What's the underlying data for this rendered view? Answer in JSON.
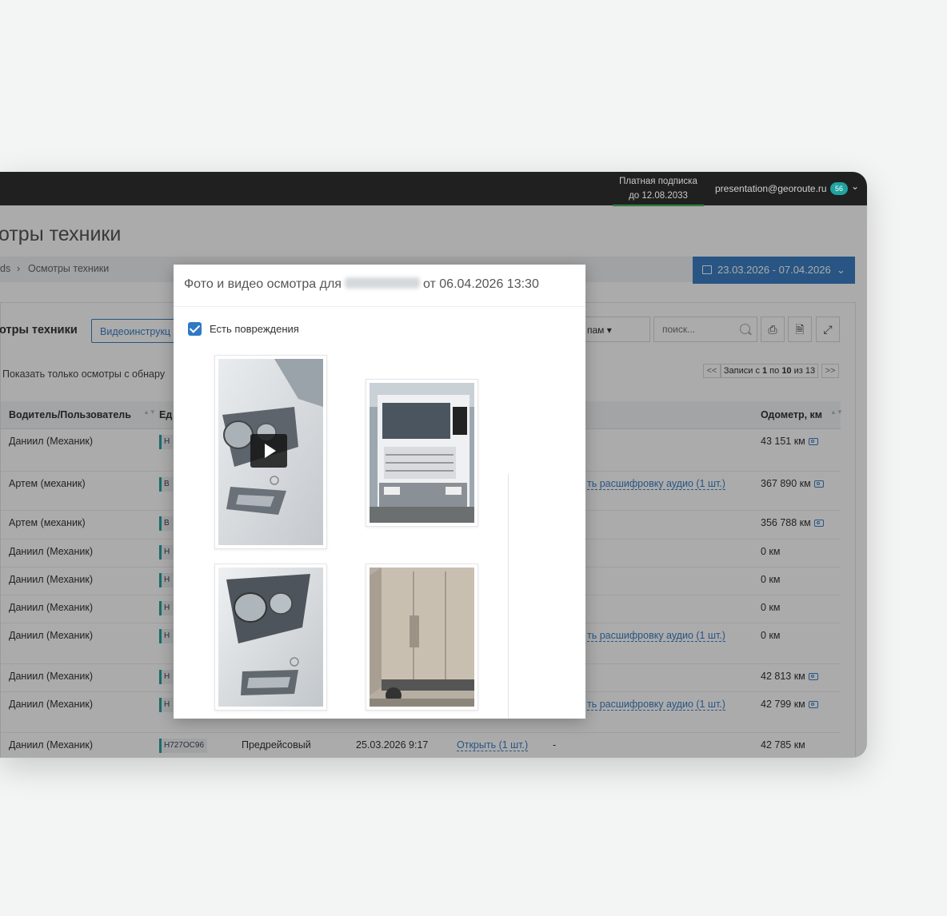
{
  "topbar": {
    "subscription_line1": "Платная подписка",
    "subscription_line2": "до 12.08.2033",
    "email": "presentation@georoute.ru",
    "badge_count": "56"
  },
  "page": {
    "title": "отры техники",
    "breadcrumb_root": "ds",
    "breadcrumb_current": "Осмотры техники",
    "date_range": "23.03.2026 - 07.04.2026"
  },
  "toolbar": {
    "panel_title": "отры техники",
    "video_button": "Видеоинструкц",
    "filter_label": "пам",
    "search_placeholder": "поиск...",
    "show_only_label": "Показать только осмотры с обнару"
  },
  "pager": {
    "prev": "<<",
    "text_prefix": "Записи с ",
    "from": "1",
    "text_mid": " по ",
    "to": "10",
    "text_suffix": " из 13",
    "next": ">>"
  },
  "table": {
    "headers": {
      "driver": "Водитель/Пользователь",
      "unit": "Ед",
      "odometer": "Одометр, км"
    },
    "rows": [
      {
        "driver": "Даниил (Механик)",
        "plate": "Н",
        "extra": "",
        "odometer": "43 151 км",
        "camera": true
      },
      {
        "driver": "Артем (механик)",
        "plate": "В",
        "extra": "ть расшифровку аудио (1 шт.)",
        "odometer": "367 890 км",
        "camera": true
      },
      {
        "driver": "Артем (механик)",
        "plate": "В",
        "extra": "",
        "odometer": "356 788 км",
        "camera": true
      },
      {
        "driver": "Даниил (Механик)",
        "plate": "Н",
        "extra": "",
        "odometer": "0 км",
        "camera": false
      },
      {
        "driver": "Даниил (Механик)",
        "plate": "Н",
        "extra": "",
        "odometer": "0 км",
        "camera": false
      },
      {
        "driver": "Даниил (Механик)",
        "plate": "Н",
        "extra": "",
        "odometer": "0 км",
        "camera": false
      },
      {
        "driver": "Даниил (Механик)",
        "plate": "Н",
        "extra": "ть расшифровку аудио (1 шт.)",
        "odometer": "0 км",
        "camera": false
      },
      {
        "driver": "Даниил (Механик)",
        "plate": "Н",
        "extra": "",
        "odometer": "42 813 км",
        "camera": true
      },
      {
        "driver": "Даниил (Механик)",
        "plate": "Н",
        "extra": "ть расшифровку аудио (1 шт.)",
        "odometer": "42 799 км",
        "camera": true
      },
      {
        "driver": "Даниил (Механик)",
        "plate": "Н727ОС96",
        "type": "Предрейсовый",
        "date": "25.03.2026 9:17",
        "open": "Открыть (1 шт.)",
        "dash": "-",
        "extra": "",
        "odometer": "42 785 км",
        "camera": false
      }
    ]
  },
  "modal": {
    "title_prefix": "Фото и видео осмотра для",
    "title_suffix": "от 06.04.2026 13:30",
    "checkbox_label": "Есть повреждения",
    "checkbox_checked": true,
    "media": [
      {
        "kind": "video",
        "subject": "headlight-closeup"
      },
      {
        "kind": "photo",
        "subject": "truck-front"
      },
      {
        "kind": "photo",
        "subject": "headlight-closeup"
      },
      {
        "kind": "photo",
        "subject": "trailer-rear"
      }
    ]
  },
  "colors": {
    "accent": "#3c7fc4",
    "topbar": "#202020",
    "plate_marker": "#24a5a3",
    "subscription_underline": "#3a9a48"
  }
}
